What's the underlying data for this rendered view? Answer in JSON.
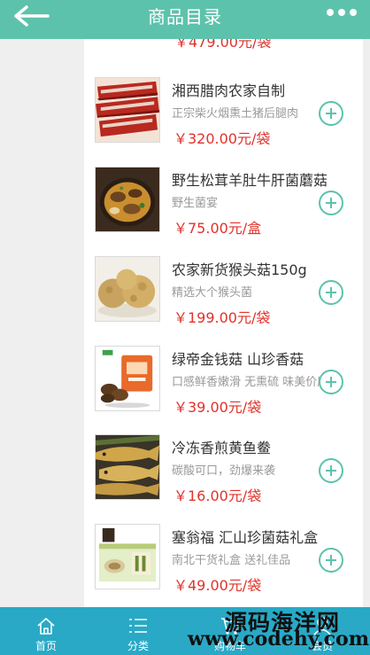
{
  "header": {
    "title": "商品目录",
    "back_icon": "arrow-left-icon",
    "more_icon": "more-dots-icon",
    "bg_color": "#5dc2ac"
  },
  "list": {
    "partial_top_price": "￥479.00元/袋",
    "items": [
      {
        "title": "湘西腊肉农家自制",
        "subtitle": "正宗柴火烟熏土猪后腿肉",
        "price": "￥320.00元/袋",
        "image": "cured-pork-image"
      },
      {
        "title": "野生松茸羊肚牛肝菌蘑菇",
        "subtitle": "野生菌宴",
        "price": "￥75.00元/盒",
        "image": "mushroom-hotpot-image"
      },
      {
        "title": "农家新货猴头菇150g",
        "subtitle": "精选大个猴头菌",
        "price": "￥199.00元/袋",
        "image": "monkey-head-mushroom-image"
      },
      {
        "title": "绿帝金钱菇 山珍香菇",
        "subtitle": "口感鲜香嫩滑 无熏硫 味美价廉",
        "price": "￥39.00元/袋",
        "image": "shiitake-package-image"
      },
      {
        "title": "冷冻香煎黄鱼鲞",
        "subtitle": "碳酸可口，劲爆来袭",
        "price": "￥16.00元/袋",
        "image": "yellow-croaker-image"
      },
      {
        "title": "塞翁福 汇山珍菌菇礼盒",
        "subtitle": "南北干货礼盒 送礼佳品",
        "price": "￥49.00元/袋",
        "image": "mushroom-gift-box-image"
      }
    ],
    "price_color": "#e2322b"
  },
  "tabbar": {
    "tabs": [
      {
        "label": "首页",
        "icon": "home-icon"
      },
      {
        "label": "分类",
        "icon": "list-icon"
      },
      {
        "label": "购物车",
        "icon": "cart-icon"
      },
      {
        "label": "会员",
        "icon": "user-icon"
      }
    ],
    "bg_color": "#29a9c6"
  },
  "watermark": {
    "line1": "源码海洋网",
    "line2": "www.codehy.com"
  }
}
